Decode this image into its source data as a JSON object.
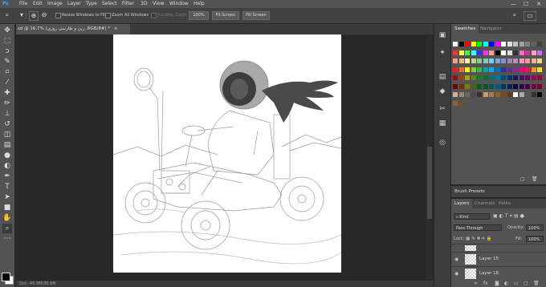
{
  "app": {
    "logo": "Ps"
  },
  "menu": [
    "File",
    "Edit",
    "Image",
    "Layer",
    "Type",
    "Select",
    "Filter",
    "3D",
    "View",
    "Window",
    "Help"
  ],
  "window_controls": {
    "minimize": "—",
    "maximize": "☐",
    "close": "✕"
  },
  "options_bar": {
    "resize_windows": "Resize Windows to Fit",
    "zoom_all": "Zoom All Windows",
    "scrubby_zoom": "Scrubby Zoom",
    "zoom_100": "100%",
    "fit_screen": "Fit Screen",
    "fill_screen": "Fill Screen"
  },
  "document_tab": {
    "title": "sd @ 16.7% (ربن و طارسي روزي, RGB/8#) *",
    "close": "×"
  },
  "status_bar": {
    "text": "Doc: 45.0M/30.6M"
  },
  "panels": {
    "swatches_tabs": [
      "Swatches",
      "Navigator"
    ],
    "brush_presets": "Brush Presets",
    "layers_tabs": [
      "Layers",
      "Channels",
      "Paths"
    ],
    "kind": "Kind",
    "blend_mode": "Pass Through",
    "opacity_label": "Opacity:",
    "opacity_value": "100%",
    "lock_label": "Lock:",
    "fill_label": "Fill:",
    "fill_value": "100%",
    "layers": [
      {
        "name": ""
      },
      {
        "name": "Layer 15"
      },
      {
        "name": "Layer 16"
      }
    ]
  },
  "swatch_colors": [
    [
      "#ffffff",
      "#000000",
      "#ff0000",
      "#ffff00",
      "#00ff00",
      "#00ffff",
      "#0000ff",
      "#ff00ff",
      "#ffffff",
      "#e0e0e0",
      "#c0c0c0",
      "#a0a0a0",
      "#808080",
      "#606060",
      "#404040"
    ],
    [
      "#ff3333",
      "#ffff33",
      "#33ff33",
      "#33ffff",
      "#3333ff",
      "#ff33ff",
      "#ff9999",
      "#000000",
      "#ffffff",
      "#dddddd",
      "#333333",
      "#ff66cc",
      "#cc3399",
      "#ff99cc",
      "#cc66ff"
    ],
    [
      "#f7a081",
      "#f9b87c",
      "#fdf498",
      "#b5d98f",
      "#89c992",
      "#7fcdbb",
      "#6dcff6",
      "#7ea7d8",
      "#8493ca",
      "#a186be",
      "#bd8cbf",
      "#f49ac1",
      "#f6989d",
      "#f4b183",
      "#fbd08f"
    ],
    [
      "#ee1d24",
      "#f26522",
      "#fff200",
      "#8dc63f",
      "#39b54a",
      "#00a99d",
      "#00aeef",
      "#0072bc",
      "#2e3192",
      "#662d91",
      "#92278f",
      "#ec008c",
      "#ed145b",
      "#f7941d",
      "#ffde17"
    ],
    [
      "#9e0b0f",
      "#a0410d",
      "#aba000",
      "#598527",
      "#197b30",
      "#007236",
      "#00746b",
      "#0076a3",
      "#004a80",
      "#003471",
      "#1b1464",
      "#440e62",
      "#630460",
      "#9e005d",
      "#9e0039"
    ],
    [
      "#790000",
      "#7b2e00",
      "#827b00",
      "#406618",
      "#005e20",
      "#005826",
      "#005952",
      "#005b7f",
      "#003663",
      "#002157",
      "#0d004c",
      "#32004b",
      "#4b0049",
      "#7b0046",
      "#7a0026"
    ],
    [
      "#c7b299",
      "#998675",
      "#736357",
      "#534741",
      "#37302d",
      "#c69c6d",
      "#a67c52",
      "#8c6239",
      "#754c24",
      "#603913",
      "#ffffff",
      "#aaaaaa",
      "#555555",
      "#333333",
      "#000000"
    ],
    [
      "#8c6239",
      "#754c24"
    ]
  ],
  "tools": [
    "move-icon",
    "marquee-icon",
    "lasso-icon",
    "quick-select-icon",
    "crop-icon",
    "eyedropper-icon",
    "healing-icon",
    "brush-icon",
    "stamp-icon",
    "history-brush-icon",
    "eraser-icon",
    "gradient-icon",
    "blur-icon",
    "dodge-icon",
    "pen-icon",
    "type-icon",
    "path-select-icon",
    "rectangle-icon",
    "hand-icon",
    "zoom-icon"
  ]
}
